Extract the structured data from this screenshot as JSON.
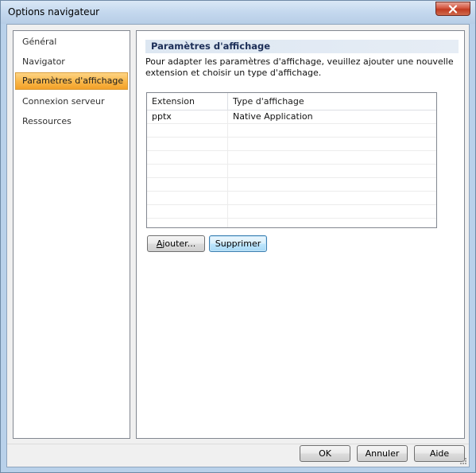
{
  "window": {
    "title": "Options navigateur"
  },
  "nav": {
    "items": [
      {
        "label": "Général",
        "selected": false
      },
      {
        "label": "Navigator",
        "selected": false
      },
      {
        "label": "Paramètres d'affichage",
        "selected": true
      },
      {
        "label": "Connexion serveur",
        "selected": false
      },
      {
        "label": "Ressources",
        "selected": false
      }
    ]
  },
  "content": {
    "section_title": "Paramètres d'affichage",
    "description": "Pour adapter les paramètres d'affichage, veuillez ajouter une nouvelle extension et choisir un type d'affichage.",
    "table": {
      "columns": [
        "Extension",
        "Type d'affichage"
      ],
      "rows": [
        {
          "extension": "pptx",
          "type": "Native Application"
        }
      ]
    },
    "buttons": {
      "add_prefix": "A",
      "add_rest": "jouter...",
      "remove": "Supprimer"
    }
  },
  "footer": {
    "ok": "OK",
    "cancel": "Annuler",
    "help": "Aide"
  },
  "colors": {
    "selection": "#f9b648",
    "header_text": "#1c2e58",
    "focus_border": "#3c7fb1"
  }
}
